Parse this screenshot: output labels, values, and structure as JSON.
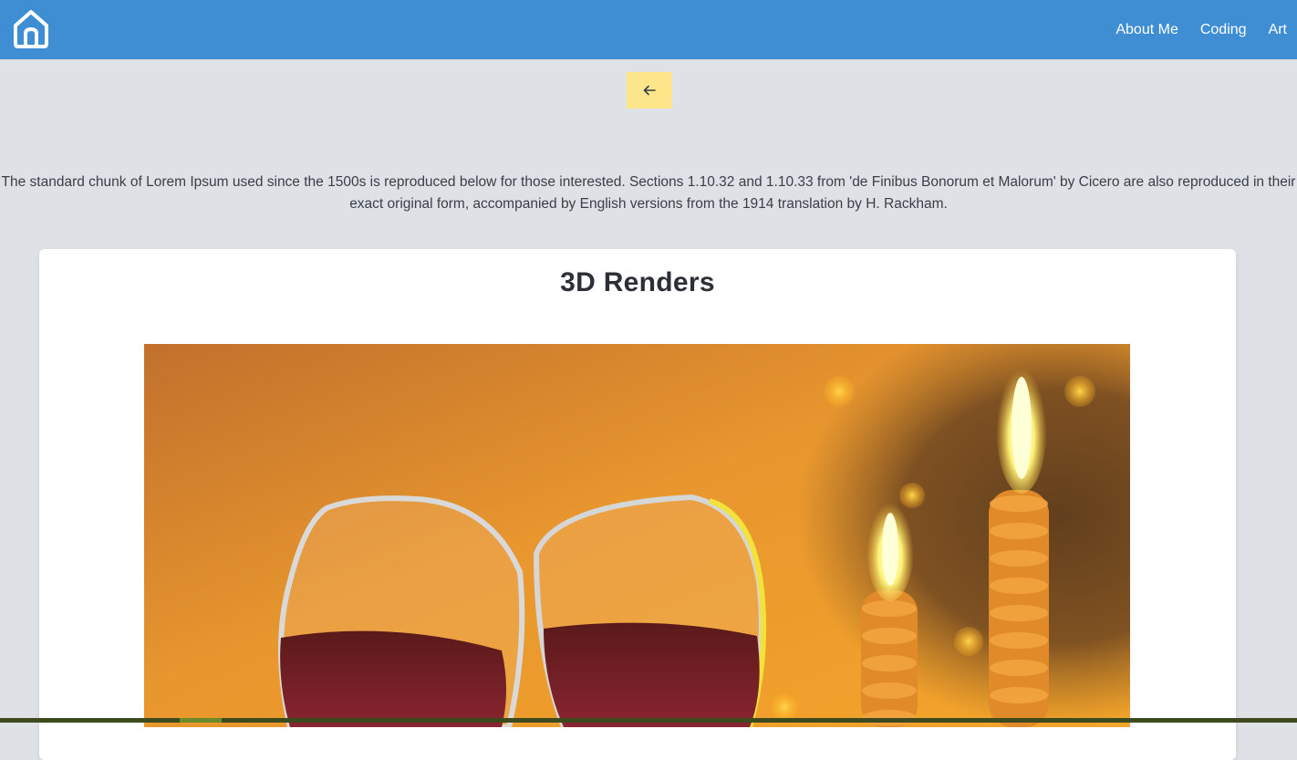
{
  "nav": {
    "home_icon": "home-icon",
    "links": [
      "About Me",
      "Coding",
      "Art"
    ]
  },
  "back_button": {
    "icon": "arrow-left-icon"
  },
  "intro_text": "The standard chunk of Lorem Ipsum used since the 1500s is reproduced below for those interested. Sections 1.10.32 and 1.10.33 from 'de Finibus Bonorum et Malorum' by Cicero are also reproduced in their exact original form, accompanied by English versions from the 1914 translation by H. Rackham.",
  "card": {
    "title": "3D Renders"
  },
  "colors": {
    "navbar": "#3f8ed3",
    "page_background": "#dee1e6",
    "back_button": "#fde68a"
  }
}
